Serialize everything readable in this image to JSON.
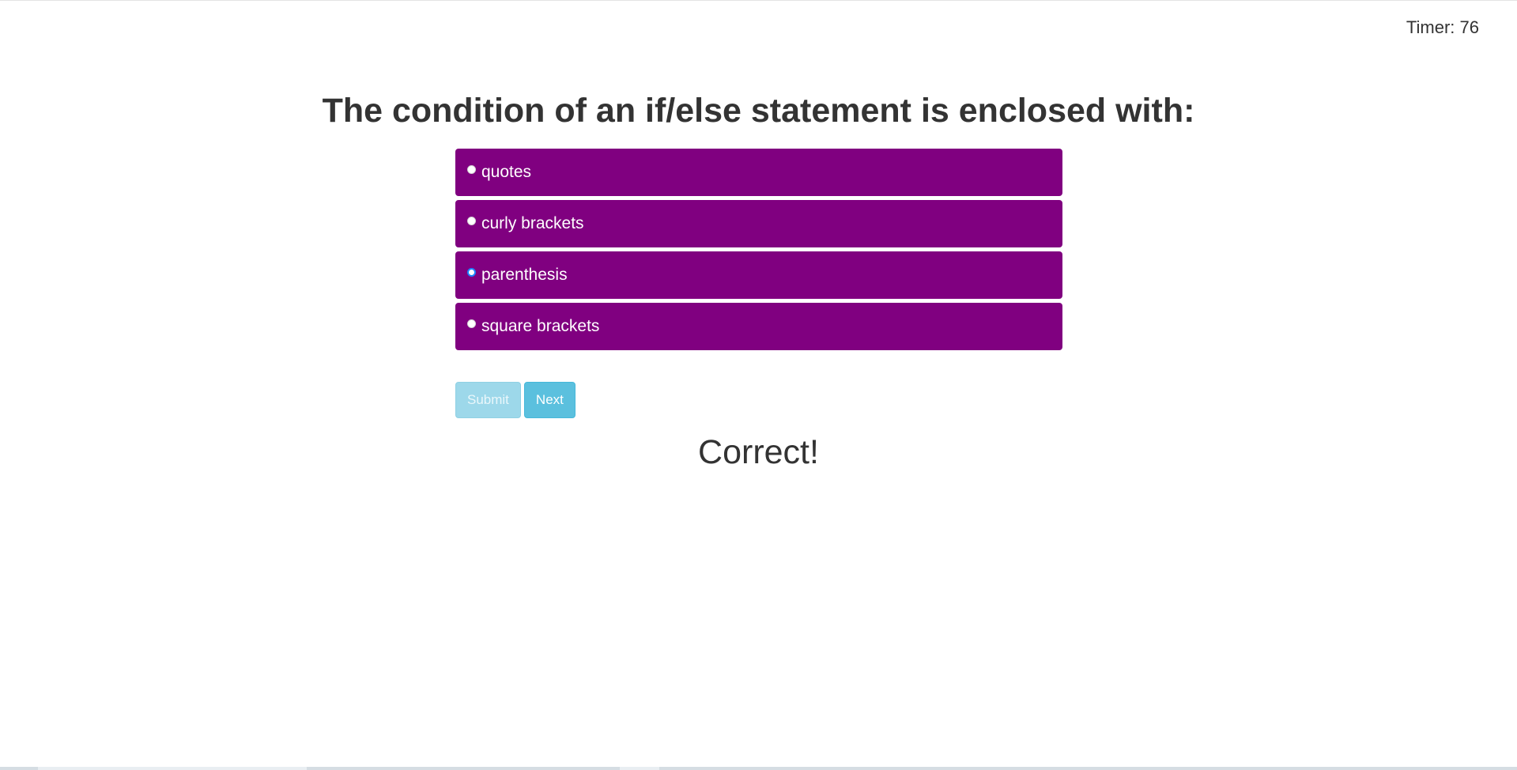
{
  "timer": {
    "label": "Timer: 76"
  },
  "question": {
    "text": "The condition of an if/else statement is enclosed with:"
  },
  "choices": [
    {
      "label": "quotes",
      "selected": false
    },
    {
      "label": "curly brackets",
      "selected": false
    },
    {
      "label": "parenthesis",
      "selected": true
    },
    {
      "label": "square brackets",
      "selected": false
    }
  ],
  "buttons": {
    "submit": "Submit",
    "next": "Next"
  },
  "result": {
    "text": "Correct!"
  },
  "colors": {
    "choice_bg": "#800080",
    "button_bg": "#5bc0de",
    "button_disabled_bg": "#9dd8ea",
    "radio_selected": "#1a84ff"
  }
}
